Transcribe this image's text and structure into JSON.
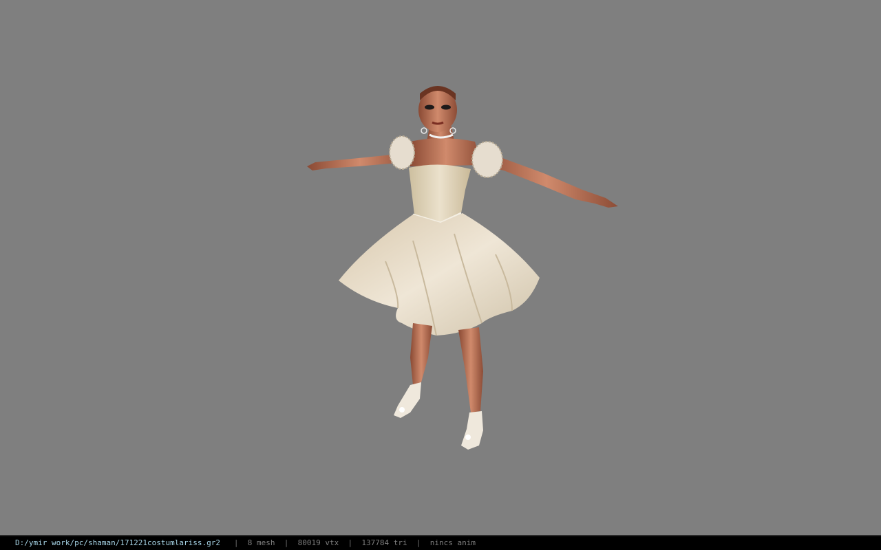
{
  "viewport": {
    "background": "#7f7f7f",
    "subject": "3d-character-model"
  },
  "statusbar": {
    "file_path": "D:/ymir work/pc/shaman/171221costumlariss.gr2",
    "separator": "|",
    "mesh_count": "8 mesh",
    "vertex_count": "80019 vtx",
    "triangle_count": "137784 tri",
    "animation": "nincs anim",
    "path_color": "#a8d6e8",
    "text_color": "#7e7e7e"
  }
}
